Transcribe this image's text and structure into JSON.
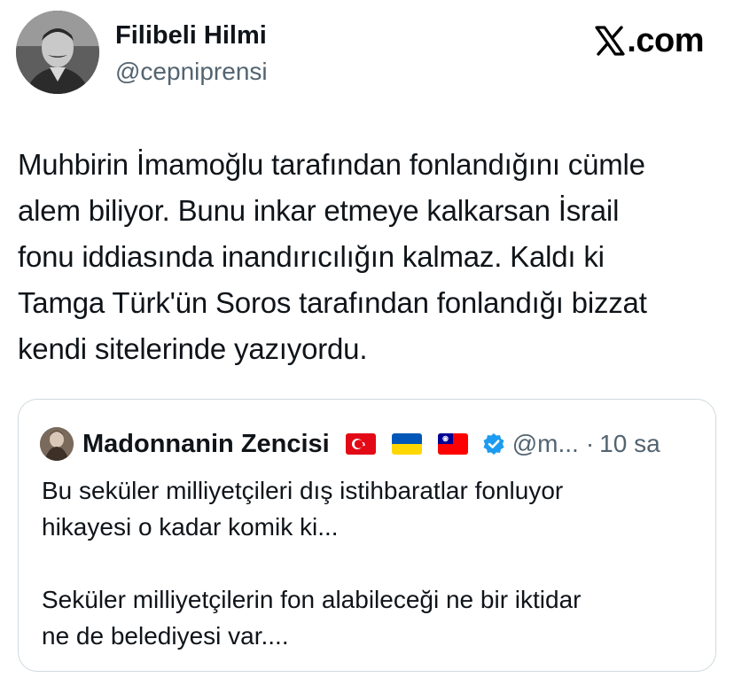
{
  "tweet": {
    "author": {
      "display_name": "Filibeli Hilmi",
      "handle": "@cepniprensi",
      "avatar_icon": "portrait-photo"
    },
    "brand": {
      "text": ".com",
      "logo_icon": "x-logo-icon"
    },
    "text": "Muhbirin İmamoğlu tarafından fonlandığını cümle\nalem biliyor. Bunu inkar etmeye kalkarsan İsrail\nfonu iddiasında inandırıcılığın kalmaz. Kaldı ki\nTamga Türk'ün Soros tarafından fonlandığı bizzat\nkendi sitelerinde yazıyordu."
  },
  "quote": {
    "author": {
      "display_name": "Madonnanin Zencisi",
      "handle": "@m...",
      "avatar_icon": "avatar-photo",
      "flags": [
        "turkey-flag-icon",
        "ukraine-flag-icon",
        "taiwan-flag-icon"
      ],
      "verified_icon": "verified-badge-icon"
    },
    "separator": "·",
    "time": "10 sa",
    "text": "Bu seküler milliyetçileri dış istihbaratlar fonluyor\nhikayesi o kadar komik ki...\n\nSeküler milliyetçilerin fon alabileceği ne bir iktidar\nne de belediyesi var...."
  },
  "colors": {
    "text": "#0f1419",
    "secondary": "#536471",
    "border": "#cfd9de",
    "verified": "#1d9bf0"
  }
}
